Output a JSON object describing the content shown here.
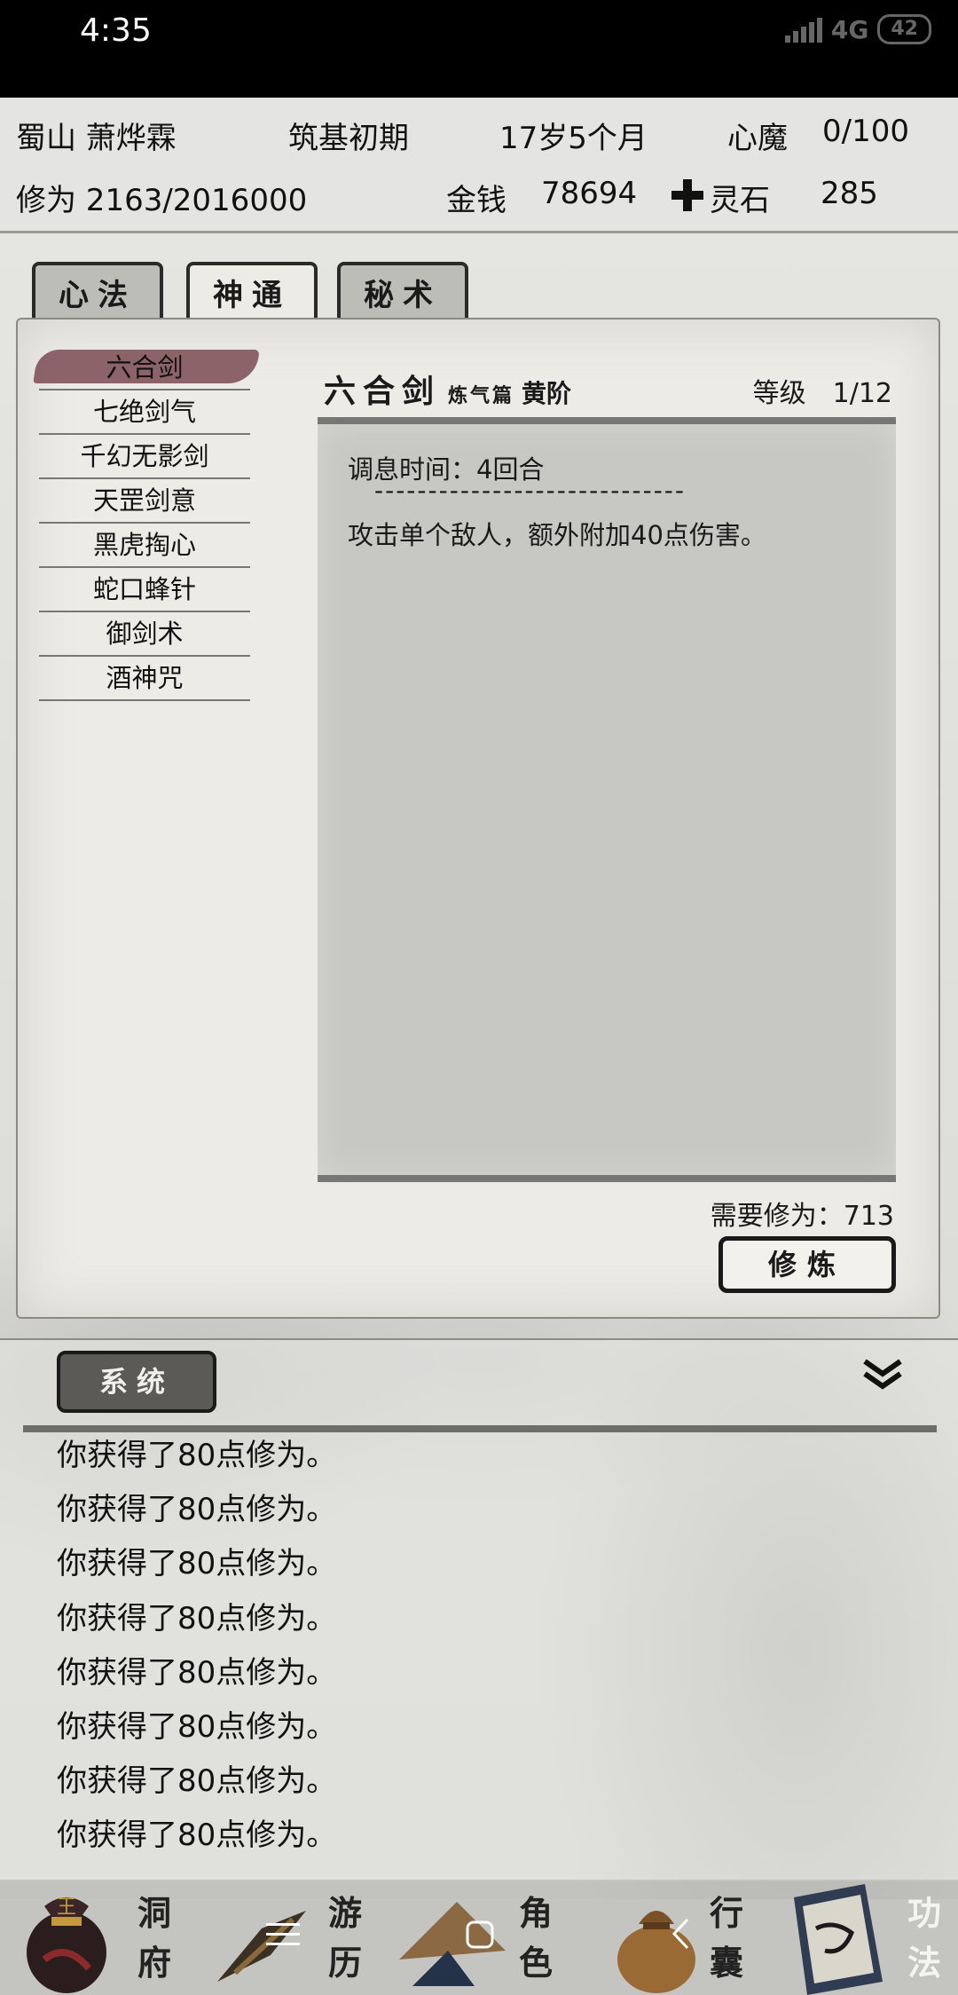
{
  "status_bar": {
    "time": "4:35",
    "network": "4G",
    "battery": "42"
  },
  "player": {
    "sect_name": "蜀山 萧烨霖",
    "realm": "筑基初期",
    "age": "17岁5个月",
    "demon_label": "心魔",
    "demon_value": "0/100",
    "cultivation": "修为 2163/2016000",
    "money_label": "金钱",
    "money_value": "78694",
    "spirit_stone_label": "灵石",
    "spirit_stone_value": "285"
  },
  "tabs": [
    {
      "label": "心法",
      "active": false
    },
    {
      "label": "神通",
      "active": true
    },
    {
      "label": "秘术",
      "active": false
    }
  ],
  "skills": [
    "六合剑",
    "七绝剑气",
    "千幻无影剑",
    "天罡剑意",
    "黑虎掏心",
    "蛇口蜂针",
    "御剑术",
    "酒神咒"
  ],
  "selected_skill": {
    "name": "六合剑",
    "chapter": "炼气篇",
    "grade": "黄阶",
    "level": "等级　1/12",
    "rest_time": "调息时间：4回合",
    "separator": "-----------------------------",
    "effect": "攻击单个敌人，额外附加40点伤害。",
    "requirement": "需要修为：713",
    "train_label": "修炼"
  },
  "log": {
    "tab_label": "系统",
    "lines": [
      "你获得了80点修为。",
      "你获得了80点修为。",
      "你获得了80点修为。",
      "你获得了80点修为。",
      "你获得了80点修为。",
      "你获得了80点修为。",
      "你获得了80点修为。",
      "你获得了80点修为。"
    ]
  },
  "bottom_nav": [
    {
      "label": "洞府",
      "icon": "pouch-character-icon"
    },
    {
      "label": "游历",
      "icon": "brush-icon"
    },
    {
      "label": "角色",
      "icon": "straw-hat-icon"
    },
    {
      "label": "行囊",
      "icon": "bag-icon"
    },
    {
      "label": "功法",
      "icon": "scroll-book-icon"
    }
  ],
  "colors": {
    "selected_skill_highlight": "#7a4b52",
    "system_button": "#5b5a56"
  }
}
